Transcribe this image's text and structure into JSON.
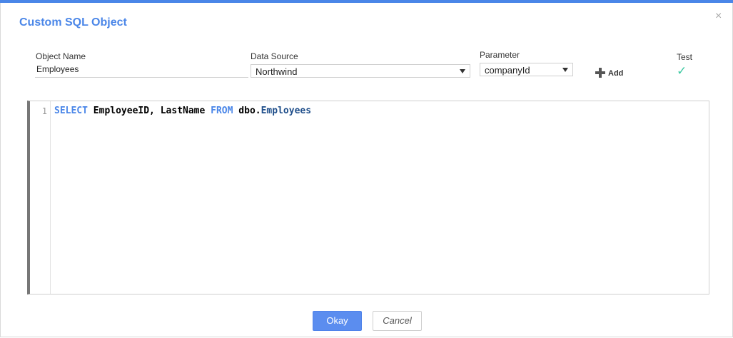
{
  "dialog": {
    "title": "Custom SQL Object",
    "close_glyph": "×"
  },
  "form": {
    "object_name": {
      "label": "Object Name",
      "value": "Employees"
    },
    "data_source": {
      "label": "Data Source",
      "value": "Northwind"
    },
    "parameter": {
      "label": "Parameter",
      "value": "companyId"
    },
    "add_label": "Add",
    "test": {
      "label": "Test",
      "icon": "check-icon",
      "glyph": "✓"
    }
  },
  "editor": {
    "line_numbers": [
      "1"
    ],
    "sql": {
      "kw1": "SELECT",
      "cols": " EmployeeID, LastName ",
      "kw2": "FROM",
      "schema": " dbo.",
      "table": "Employees"
    }
  },
  "footer": {
    "okay_label": "Okay",
    "cancel_label": "Cancel"
  },
  "colors": {
    "accent": "#4a86e8",
    "check": "#3fc9a3",
    "ok_button": "#5b8def"
  }
}
